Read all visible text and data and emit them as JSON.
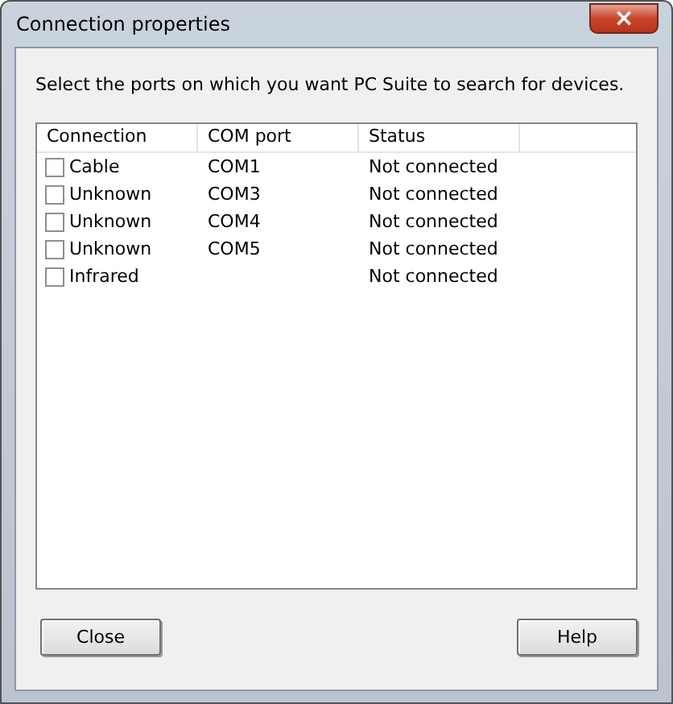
{
  "window": {
    "title": "Connection properties",
    "close_button": "×"
  },
  "instruction": "Select the ports on which you want PC Suite to search for devices.",
  "table": {
    "columns": [
      "Connection",
      "COM port",
      "Status"
    ],
    "rows": [
      {
        "connection": "Cable",
        "com_port": "COM1",
        "status": "Not connected",
        "checked": false
      },
      {
        "connection": "Unknown",
        "com_port": "COM3",
        "status": "Not connected",
        "checked": false
      },
      {
        "connection": "Unknown",
        "com_port": "COM4",
        "status": "Not connected",
        "checked": false
      },
      {
        "connection": "Unknown",
        "com_port": "COM5",
        "status": "Not connected",
        "checked": false
      },
      {
        "connection": "Infrared",
        "status": "Not connected",
        "checked": false
      }
    ]
  },
  "buttons": [
    "Close",
    "Help"
  ]
}
